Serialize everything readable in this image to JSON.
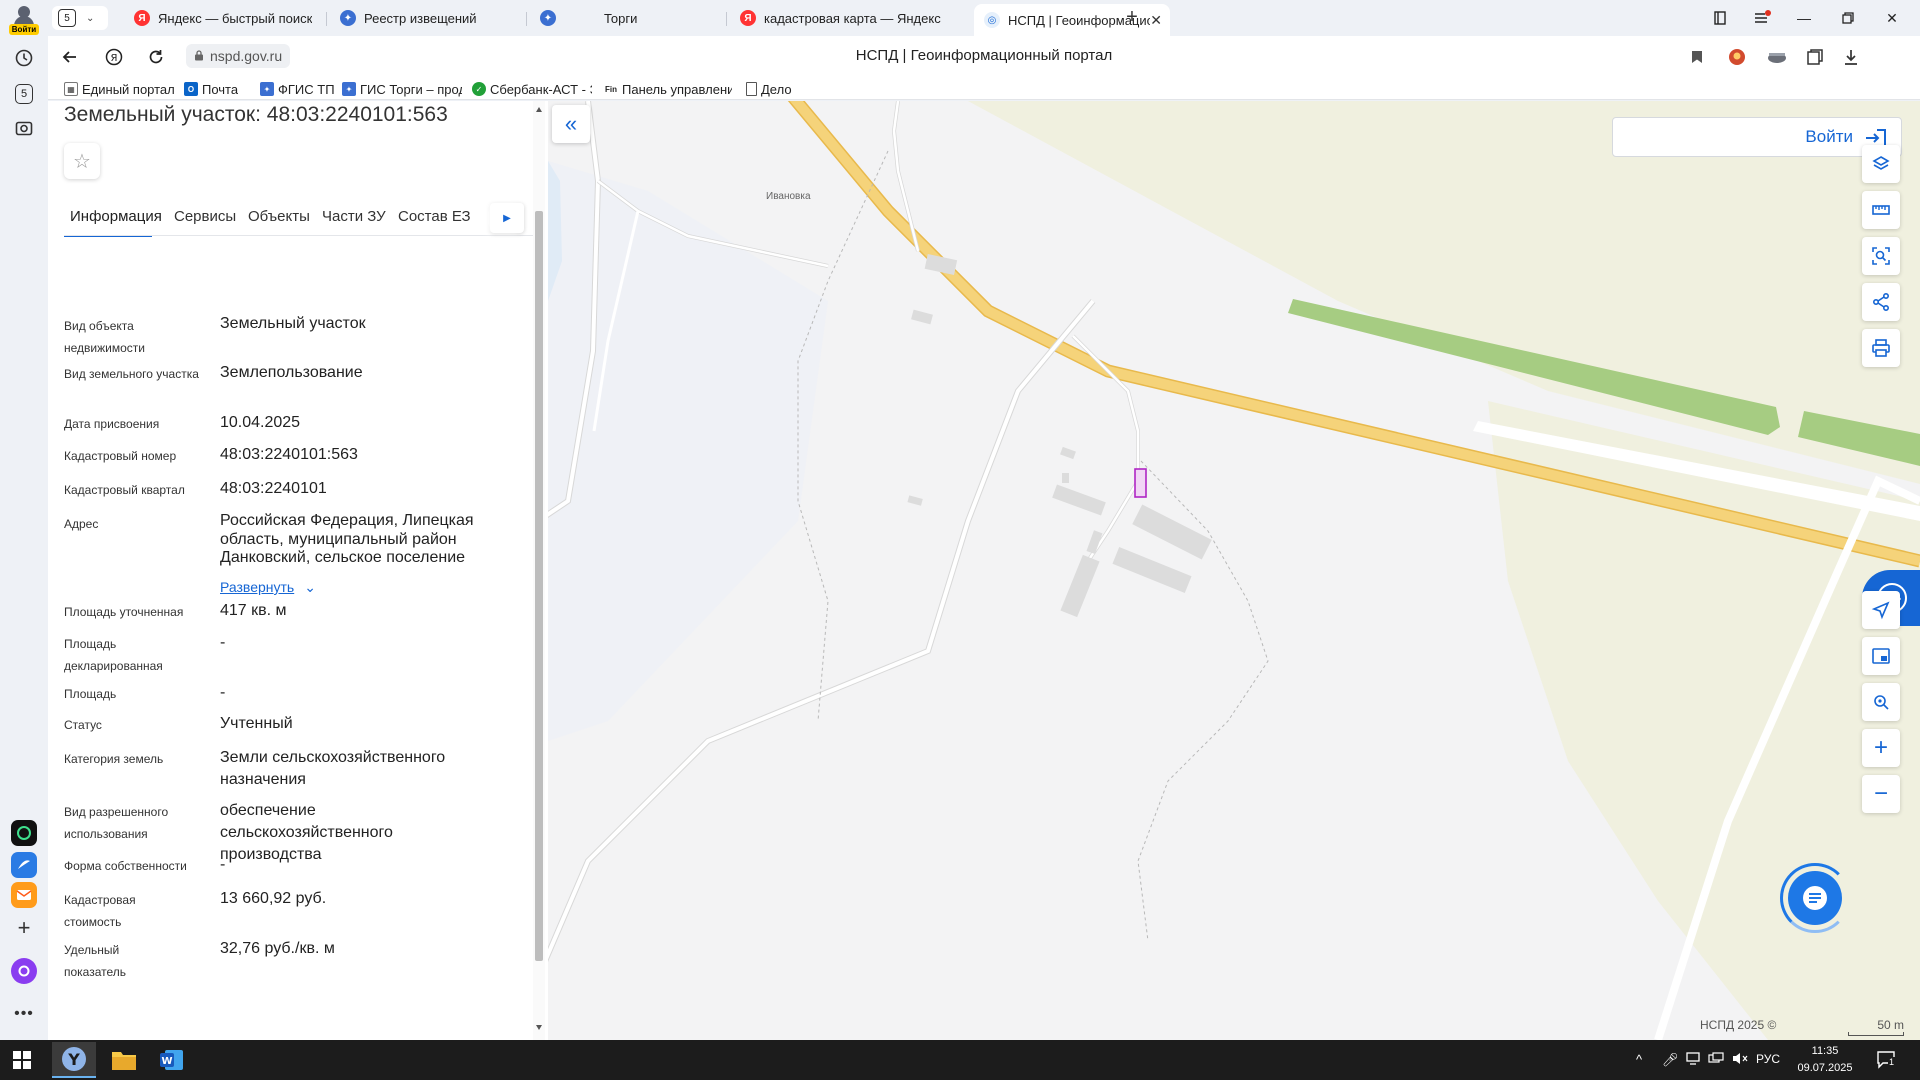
{
  "browser": {
    "profile_login": "Войти",
    "tab_count": "5",
    "rail_count": "5",
    "tabs": [
      {
        "title": "Яндекс — быстрый поиск",
        "favicon": "yandex-icon"
      },
      {
        "title": "Реестр извещений",
        "favicon": "emblem-icon"
      },
      {
        "title": "Торги",
        "favicon": "emblem-icon"
      },
      {
        "title": "кадастровая карта — Яндекс",
        "favicon": "yandex-icon"
      },
      {
        "title": "НСПД | Геоинформационный портал",
        "favicon": "nspd-icon",
        "active": true
      }
    ],
    "url": "nspd.gov.ru",
    "page_title": "НСПД | Геоинформационный портал",
    "bookmarks": [
      {
        "label": "Единый портал"
      },
      {
        "label": "Почта"
      },
      {
        "label": "ФГИС ТП"
      },
      {
        "label": "ГИС Торги – прод"
      },
      {
        "label": "Сбербанк-АСТ - Э"
      },
      {
        "label": "Панель управлени"
      },
      {
        "label": "Дело"
      }
    ]
  },
  "panel": {
    "title": "Земельный участок: 48:03:2240101:563",
    "tabs": [
      "Информация",
      "Сервисы",
      "Объекты",
      "Части ЗУ",
      "Состав ЕЗ"
    ],
    "active_tab": "Информация",
    "expand_label": "Развернуть",
    "rows": [
      {
        "label": "Вид объекта недвижимости",
        "value": "Земельный участок"
      },
      {
        "label": "Вид земельного участка",
        "value": "Землепользование"
      },
      {
        "label": "Дата присвоения",
        "value": "10.04.2025"
      },
      {
        "label": "Кадастровый номер",
        "value": "48:03:2240101:563"
      },
      {
        "label": "Кадастровый квартал",
        "value": "48:03:2240101"
      },
      {
        "label": "Адрес",
        "value": "Российская Федерация, Липецкая область, муниципальный район Данковский, сельское поселение"
      },
      {
        "label": "Площадь уточненная",
        "value": "417 кв. м"
      },
      {
        "label": "Площадь декларированная",
        "value": "-"
      },
      {
        "label": "Площадь",
        "value": "-"
      },
      {
        "label": "Статус",
        "value": "Учтенный"
      },
      {
        "label": "Категория земель",
        "value": "Земли сельскохозяйственного назначения"
      },
      {
        "label": "Вид разрешенного использования",
        "value": "обеспечение сельскохозяйственного производства"
      },
      {
        "label": "Форма собственности",
        "value": "-"
      },
      {
        "label": "Кадастровая стоимость",
        "value": "13 660,92 руб."
      },
      {
        "label": "Удельный показатель",
        "value": "32,76 руб./кв. м"
      }
    ]
  },
  "map": {
    "login_label": "Войти",
    "village_label": "Ивановка",
    "copyright": "НСПД 2025 ©",
    "scale_label": "50 m",
    "colors": {
      "road": "#f5d37a",
      "road_edge": "#e8b94c",
      "greenbelt": "#a6cc82",
      "field": "#f0f0df",
      "parcel": "#b025c4",
      "accent": "#1666d4"
    }
  },
  "taskbar": {
    "tray_lang": "РУС",
    "time": "11:35",
    "date": "09.07.2025",
    "notifications": "1"
  }
}
